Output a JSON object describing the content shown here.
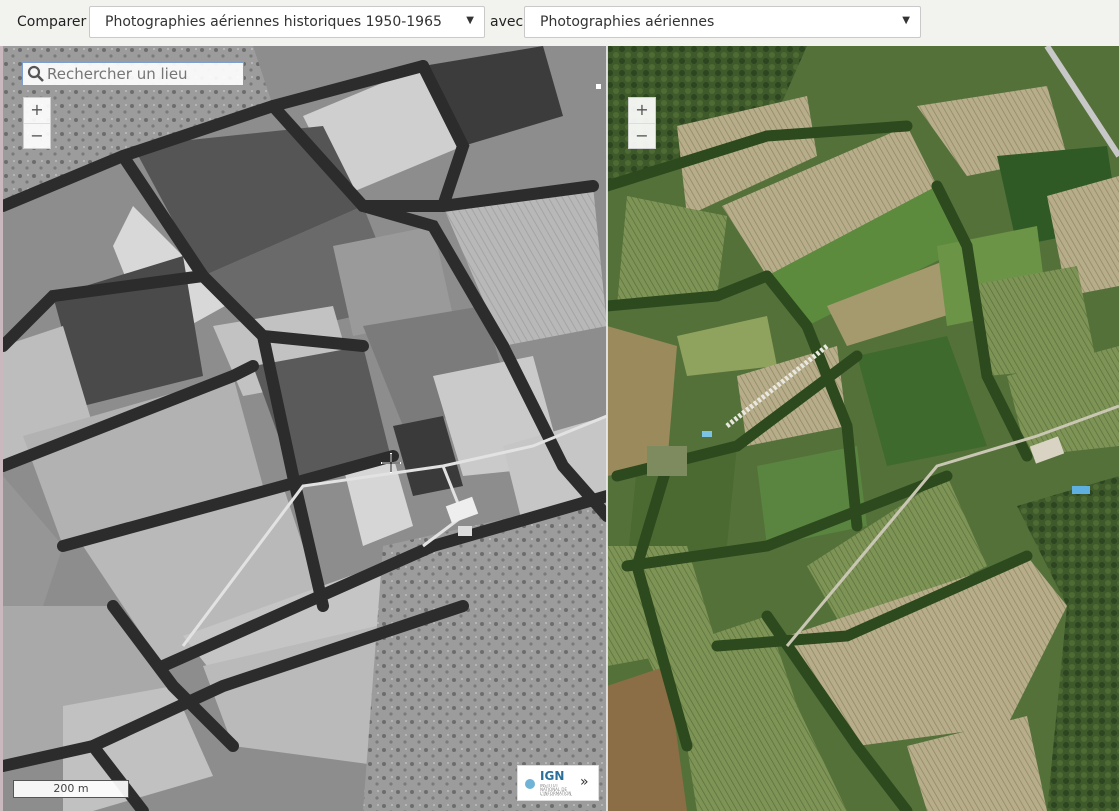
{
  "toolbar": {
    "compare_label": "Comparer",
    "left_layer": "Photographies aériennes historiques 1950-1965",
    "with_label": "avec",
    "right_layer": "Photographies aériennes"
  },
  "search": {
    "placeholder": "Rechercher un lieu"
  },
  "zoom": {
    "in": "+",
    "out": "−"
  },
  "scale": {
    "label": "200 m"
  },
  "attribution": {
    "logo": "IGN",
    "subtitle": "INSTITUT NATIONAL DE L'INFORMATION GÉOGRAPHIQUE ET FORESTIÈRE",
    "expand": "»"
  },
  "colors": {
    "historic": "#7a7a7a",
    "modern": "#5d7a3c",
    "accent": "#2a6f9a"
  },
  "icons": {
    "search": "magnifier-icon",
    "cursor": "crosshair-icon",
    "expand": "chevron-double-right-icon"
  }
}
